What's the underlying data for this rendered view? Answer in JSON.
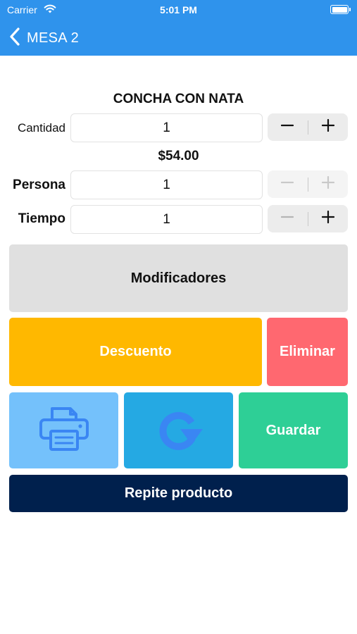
{
  "status_bar": {
    "carrier": "Carrier",
    "time": "5:01 PM"
  },
  "nav": {
    "back_label": "MESA 2"
  },
  "product": {
    "name": "CONCHA CON NATA",
    "price": "$54.00"
  },
  "fields": {
    "cantidad": {
      "label": "Cantidad",
      "value": "1"
    },
    "persona": {
      "label": "Persona",
      "value": "1"
    },
    "tiempo": {
      "label": "Tiempo",
      "value": "1"
    }
  },
  "buttons": {
    "modificadores": "Modificadores",
    "descuento": "Descuento",
    "eliminar": "Eliminar",
    "guardar": "Guardar",
    "repite": "Repite producto"
  },
  "icons": {
    "back": "chevron-left-icon",
    "print": "printer-icon",
    "refresh": "refresh-icon",
    "minus": "minus-icon",
    "plus": "plus-icon"
  },
  "colors": {
    "nav_blue": "#2f93ec",
    "modificadores": "#e0e0e0",
    "descuento": "#ffb800",
    "eliminar": "#ff6870",
    "print": "#74c1fb",
    "refresh": "#25a9e3",
    "guardar": "#2ecf96",
    "repite": "#00204d"
  }
}
